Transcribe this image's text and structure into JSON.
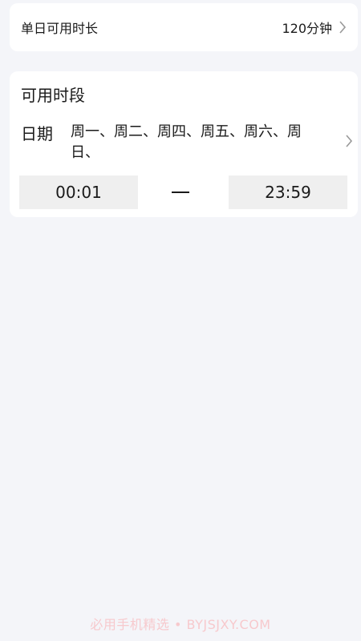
{
  "daily_limit": {
    "label": "单日可用时长",
    "value": "120分钟",
    "icon": "chevron-right-icon"
  },
  "available_period": {
    "title": "可用时段",
    "date_label": "日期",
    "date_value": "周一、周二、周四、周五、周六、周日、",
    "start_time": "00:01",
    "end_time": "23:59"
  },
  "watermark": "必用手机精选 • BYJSJXY.COM",
  "colors": {
    "background": "#f4f5f9",
    "card": "#ffffff",
    "time_box": "#efefef",
    "chevron": "#999999",
    "watermark": "#f7c9cd"
  }
}
